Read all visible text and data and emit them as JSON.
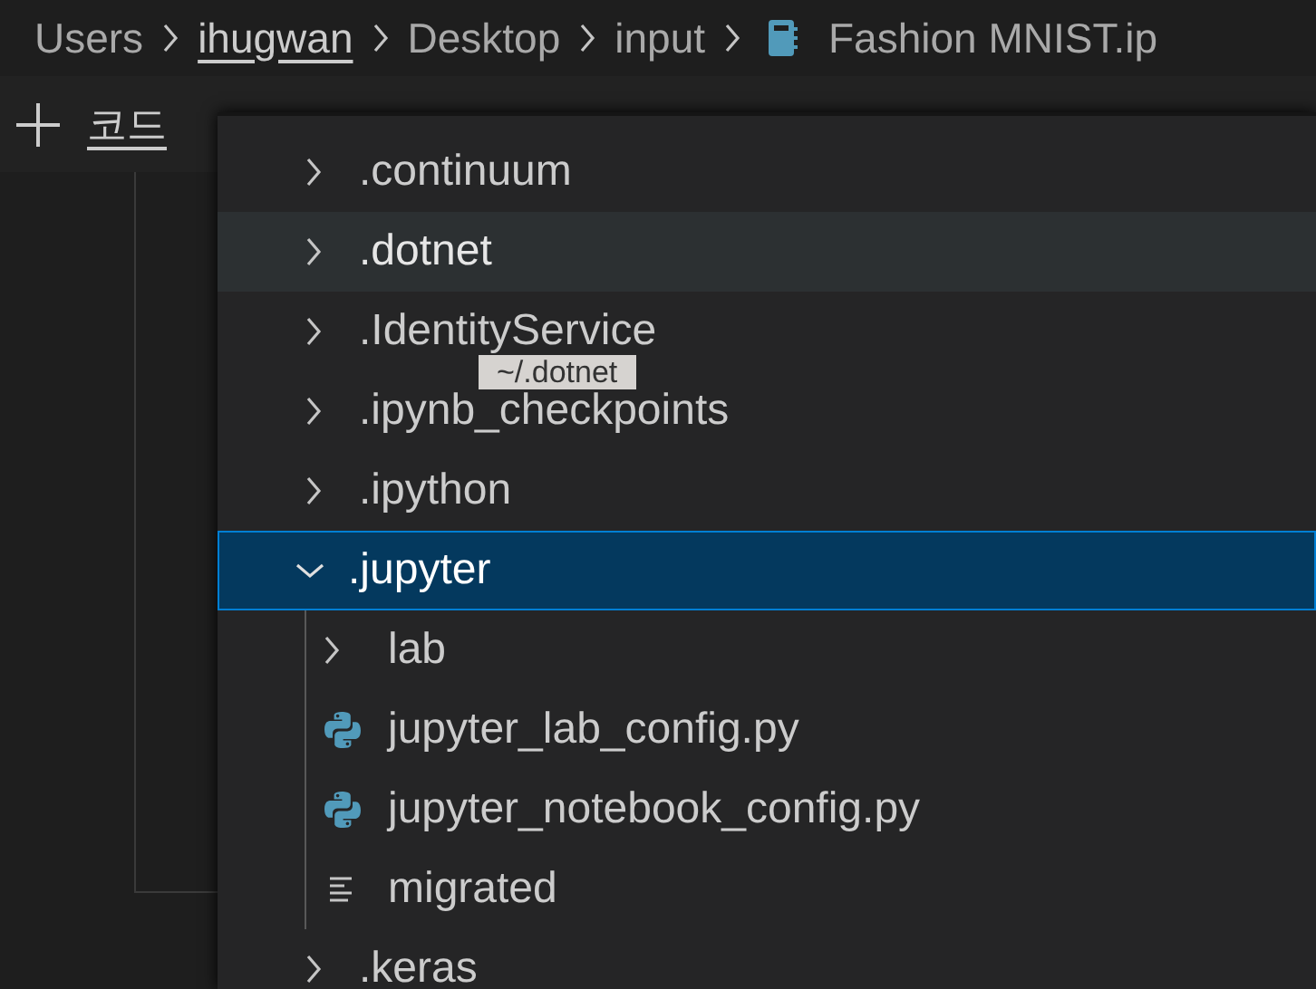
{
  "breadcrumbs": [
    {
      "label": "Users",
      "selected": false,
      "kind": "folder"
    },
    {
      "label": "ihugwan",
      "selected": true,
      "kind": "folder"
    },
    {
      "label": "Desktop",
      "selected": false,
      "kind": "folder"
    },
    {
      "label": "input",
      "selected": false,
      "kind": "folder"
    },
    {
      "label": "Fashion MNIST.ip",
      "selected": false,
      "kind": "notebook"
    }
  ],
  "toolbar": {
    "add_code_label": "코드"
  },
  "picker": {
    "items": [
      {
        "label": ".continuum",
        "kind": "folder",
        "expanded": false,
        "selected": false,
        "hovered": false
      },
      {
        "label": ".dotnet",
        "kind": "folder",
        "expanded": false,
        "selected": false,
        "hovered": true
      },
      {
        "label": ".IdentityService",
        "kind": "folder",
        "expanded": false,
        "selected": false,
        "hovered": false
      },
      {
        "label": ".ipynb_checkpoints",
        "kind": "folder",
        "expanded": false,
        "selected": false,
        "hovered": false
      },
      {
        "label": ".ipython",
        "kind": "folder",
        "expanded": false,
        "selected": false,
        "hovered": false
      },
      {
        "label": ".jupyter",
        "kind": "folder",
        "expanded": true,
        "selected": true,
        "hovered": false,
        "children": [
          {
            "label": "lab",
            "kind": "folder",
            "expanded": false,
            "selected": false,
            "hovered": false
          },
          {
            "label": "jupyter_lab_config.py",
            "kind": "python",
            "selected": false,
            "hovered": false
          },
          {
            "label": "jupyter_notebook_config.py",
            "kind": "python",
            "selected": false,
            "hovered": false
          },
          {
            "label": "migrated",
            "kind": "text",
            "selected": false,
            "hovered": false
          }
        ]
      },
      {
        "label": ".keras",
        "kind": "folder",
        "expanded": false,
        "selected": false,
        "hovered": false
      }
    ],
    "tooltip": "~/.dotnet"
  }
}
